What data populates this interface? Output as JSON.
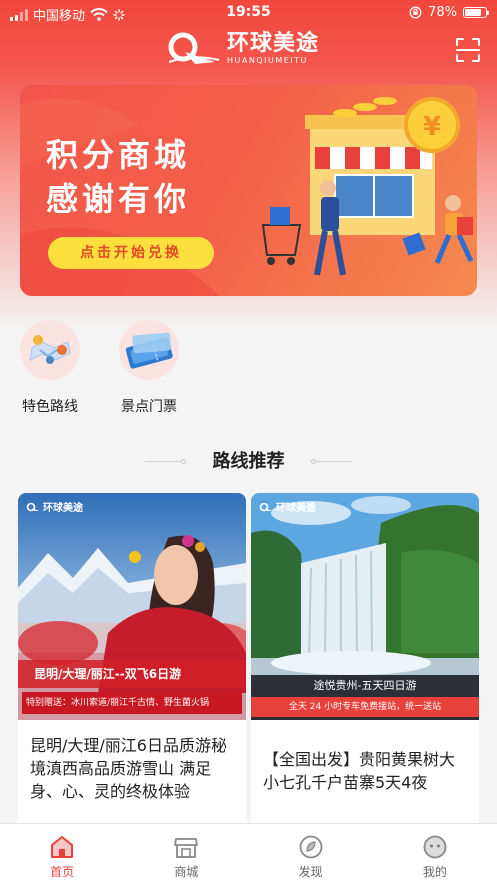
{
  "status_bar": {
    "carrier": "中国移动",
    "time": "19:55",
    "battery": "78%",
    "battery_level": 0.78
  },
  "logo": {
    "name_cn": "环球美途",
    "name_en": "HUANQIUMEITU"
  },
  "banner": {
    "title_line1": "积分商城",
    "title_line2": "感谢有你",
    "cta": "点击开始兑换",
    "coin_symbol": "¥"
  },
  "categories": [
    {
      "label": "特色路线",
      "icon": "map-route-icon"
    },
    {
      "label": "景点门票",
      "icon": "ticket-icon"
    }
  ],
  "section": {
    "title": "路线推荐"
  },
  "cards": [
    {
      "brand": "环球美途",
      "overlay_title": "昆明/大理/丽江--双飞6日游",
      "overlay_sub": "特别赠送：冰川索道/丽江千古情、野生菌火锅",
      "title": "昆明/大理/丽江6日品质游秘境滇西高品质游雪山 满足身、心、灵的终极体验"
    },
    {
      "brand": "环球美途",
      "overlay_title": "途悦贵州-五天四日游",
      "overlay_sub": "全天 24 小时专车免费接站，统一送站",
      "title": "【全国出发】贵阳黄果树大小七孔千户苗寨5天4夜"
    }
  ],
  "tabbar": {
    "items": [
      {
        "label": "首页",
        "icon": "home-icon",
        "active": true
      },
      {
        "label": "商城",
        "icon": "shop-icon",
        "active": false
      },
      {
        "label": "发现",
        "icon": "discover-icon",
        "active": false
      },
      {
        "label": "我的",
        "icon": "profile-icon",
        "active": false
      }
    ]
  },
  "colors": {
    "brand_red": "#f2473c",
    "cta_yellow": "#fde03d",
    "active_tab": "#e8413b"
  }
}
